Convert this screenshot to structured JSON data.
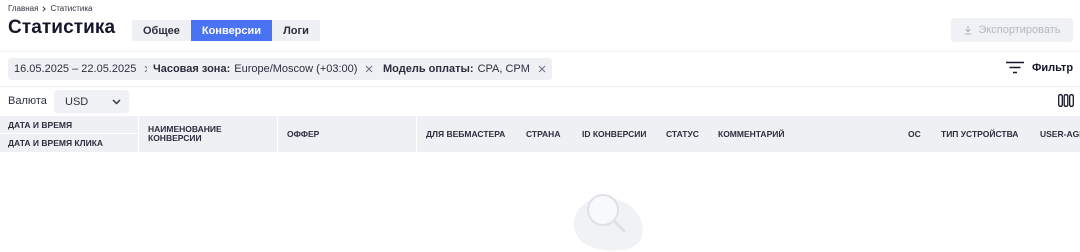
{
  "breadcrumb": {
    "home": "Главная",
    "current": "Статистика"
  },
  "page": {
    "title": "Статистика"
  },
  "tabs": [
    {
      "label": "Общее",
      "active": false
    },
    {
      "label": "Конверсии",
      "active": true
    },
    {
      "label": "Логи",
      "active": false
    }
  ],
  "toolbar": {
    "export_label": "Экспортировать"
  },
  "filters": {
    "date_range": "16.05.2025 – 22.05.2025",
    "timezone": {
      "key": "Часовая зона:",
      "value": "Europe/Moscow (+03:00)"
    },
    "payment_model": {
      "key": "Модель оплаты:",
      "value": "CPA, CPM"
    },
    "filter_label": "Фильтр"
  },
  "currency": {
    "label": "Валюта",
    "selected": "USD"
  },
  "table": {
    "date_time": "Дата и время",
    "click_date_time": "Дата и время клика",
    "columns": [
      "Наименование конверсии",
      "Оффер",
      "Для вебмастера",
      "Страна",
      "ID конверсии",
      "Статус",
      "Комментарий",
      "ОС",
      "Тип устройства",
      "User-Agent"
    ]
  },
  "colors": {
    "accent": "#4a73f3",
    "surface": "#eef0f4",
    "disabled_text": "#b4b8c2"
  },
  "icons": [
    "chevron-right-icon",
    "download-icon",
    "close-icon",
    "filter-icon",
    "chevron-down-icon",
    "columns-icon",
    "search-icon"
  ]
}
